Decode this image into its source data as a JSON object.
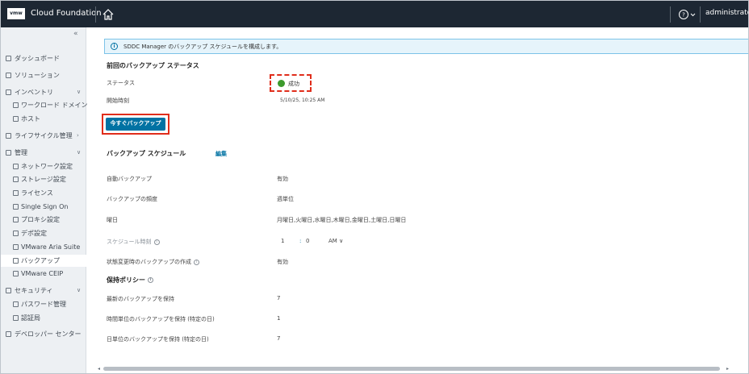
{
  "header": {
    "logo": "vmw",
    "app_title": "Cloud Foundation",
    "help_icon": "help-circle-icon",
    "user": "administrator"
  },
  "sidebar": {
    "collapse": "«",
    "items": [
      {
        "label": "ダッシュボード",
        "icon": "dashboard-icon"
      },
      {
        "label": "ソリューション",
        "icon": "solutions-icon"
      },
      {
        "label": "インベントリ",
        "icon": "inventory-icon"
      },
      {
        "label": "ワークロード ドメイン",
        "icon": "workload-domain-icon"
      },
      {
        "label": "ホスト",
        "icon": "host-icon"
      },
      {
        "label": "ライフサイクル管理",
        "icon": "lifecycle-icon"
      },
      {
        "label": "管理",
        "icon": "admin-icon"
      },
      {
        "label": "ネットワーク設定",
        "icon": "network-icon"
      },
      {
        "label": "ストレージ設定",
        "icon": "storage-icon"
      },
      {
        "label": "ライセンス",
        "icon": "license-icon"
      },
      {
        "label": "Single Sign On",
        "icon": "sso-icon"
      },
      {
        "label": "プロキシ設定",
        "icon": "proxy-icon"
      },
      {
        "label": "デポ設定",
        "icon": "depot-icon"
      },
      {
        "label": "VMware Aria Suite",
        "icon": "aria-icon"
      },
      {
        "label": "バックアップ",
        "icon": "backup-icon"
      },
      {
        "label": "VMware CEIP",
        "icon": "ceip-icon"
      },
      {
        "label": "セキュリティ",
        "icon": "security-icon"
      },
      {
        "label": "パスワード管理",
        "icon": "password-icon"
      },
      {
        "label": "認証局",
        "icon": "certificate-icon"
      },
      {
        "label": "デベロッパー センター",
        "icon": "developer-icon"
      }
    ]
  },
  "banner": {
    "message": "SDDC Manager のバックアップ スケジュールを構成します。"
  },
  "last_backup": {
    "title": "前回のバックアップ ステータス",
    "status_label": "ステータス",
    "status_value": "成功",
    "time_label": "開始時刻",
    "time_value": "5/10/25, 10:25 AM",
    "backup_now": "今すぐバックアップ"
  },
  "schedule": {
    "title": "バックアップ スケジュール",
    "edit": "編集",
    "auto_label": "自動バックアップ",
    "auto_value": "有効",
    "frequency_label": "バックアップの頻度",
    "frequency_value": "週単位",
    "days_label": "曜日",
    "days_value": "月曜日,火曜日,水曜日,木曜日,金曜日,土曜日,日曜日",
    "time_label": "スケジュール時刻",
    "hour": "1",
    "minute": "0",
    "ampm": "AM",
    "state_change_label": "状態変更時のバックアップの作成",
    "state_change_value": "有効"
  },
  "retention": {
    "title": "保持ポリシー",
    "recent_label": "最新のバックアップを保持",
    "recent_value": "7",
    "hourly_label": "時間単位のバックアップを保持 (特定の日)",
    "hourly_value": "1",
    "daily_label": "日単位のバックアップを保持 (特定の日)",
    "daily_value": "7"
  },
  "colors": {
    "header_bg": "#1d2733",
    "primary": "#0072a3",
    "success": "#3d9a2d",
    "highlight": "#e02d1b"
  }
}
